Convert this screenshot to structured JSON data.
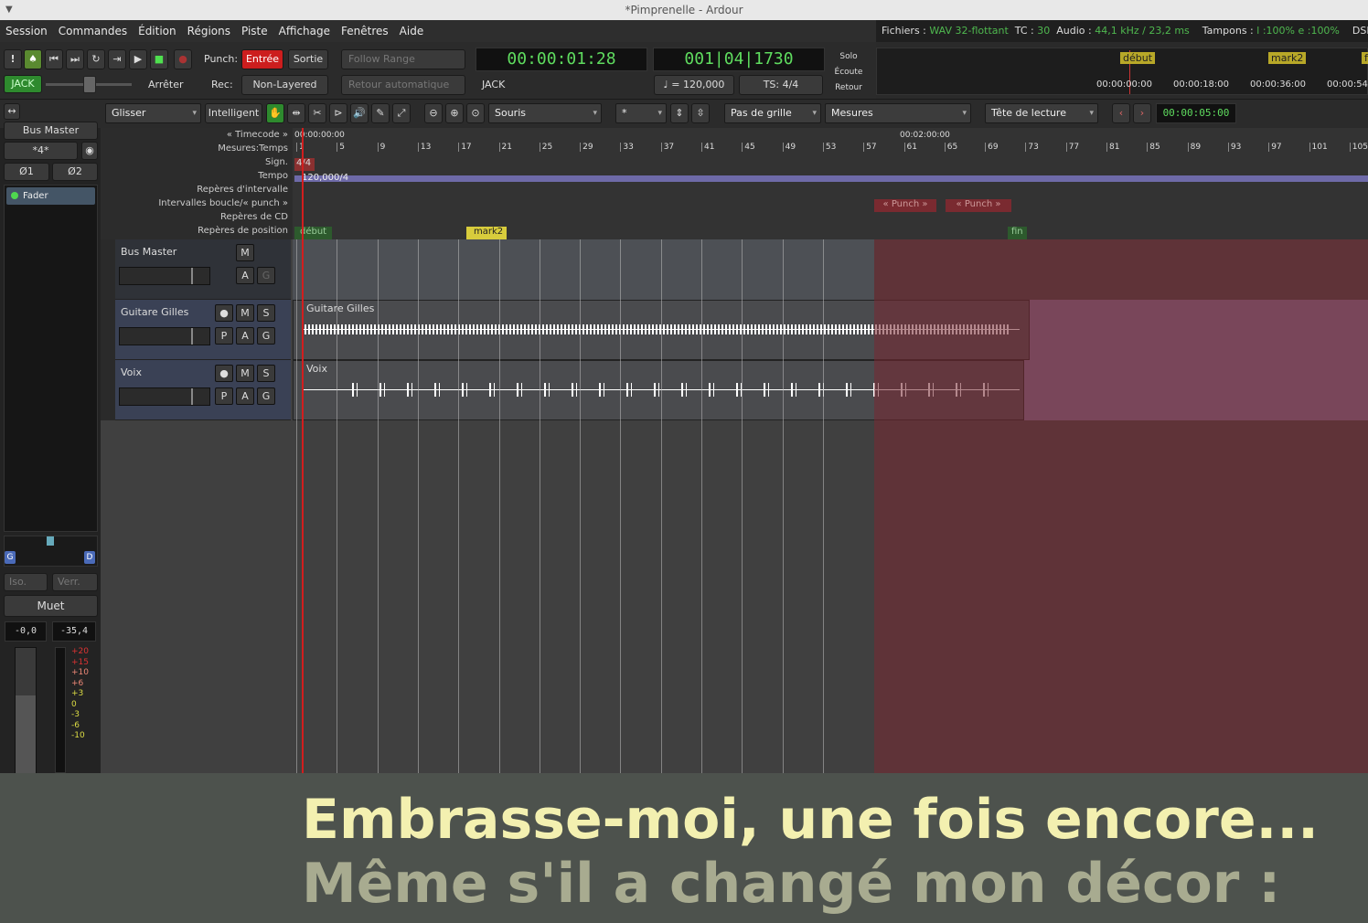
{
  "window": {
    "title": "*Pimprenelle - Ardour"
  },
  "menu": [
    "Session",
    "Commandes",
    "Édition",
    "Régions",
    "Piste",
    "Affichage",
    "Fenêtres",
    "Aide"
  ],
  "status": {
    "files_label": "Fichiers :",
    "files_value": "WAV 32-flottant",
    "tc_label": "TC :",
    "tc_value": "30",
    "audio_label": "Audio :",
    "audio_value": "44,1 kHz / 23,2 ms",
    "buffers_label": "Tampons :",
    "buffers_value": "l :100% e :100%",
    "dsp_label": "DSP :"
  },
  "transport": {
    "punch_label": "Punch:",
    "punch_in": "Entrée",
    "punch_out": "Sortie",
    "follow_range": "Follow Range",
    "auto_return": "Retour automatique",
    "rec_label": "Rec:",
    "rec_mode": "Non-Layered",
    "jack_button": "JACK",
    "stop_label": "Arrêter",
    "jack_label": "JACK",
    "clock_primary": "00:00:01:28",
    "clock_secondary": "001|04|1730",
    "tempo": "♩ = 120,000",
    "ts": "TS: 4/4",
    "solo": "Solo",
    "ecoute": "Écoute",
    "retour": "Retour"
  },
  "minitimeline": {
    "marker1": "début",
    "marker2": "mark2",
    "marker3": "f",
    "t0": "00:00:00:00",
    "t1": "00:00:18:00",
    "t2": "00:00:36:00",
    "t3": "00:00:54:"
  },
  "toolbar": {
    "edit_mode": "Glisser",
    "smart": "Intelligent",
    "edit_point": "Souris",
    "zoom_focus": "*",
    "grid": "Pas de grille",
    "grid_unit": "Mesures",
    "playhead": "Tête de lecture",
    "nudge_clock": "00:00:05:00"
  },
  "editor_mixer": {
    "strip_name": "Bus Master",
    "input": "*4*",
    "phase1": "Ø1",
    "phase2": "Ø2",
    "fader_label": "Fader",
    "pan_left": "G",
    "pan_right": "D",
    "iso": "Iso.",
    "verr": "Verr.",
    "mute": "Muet",
    "gain": "-0,0",
    "peak": "-35,4",
    "meter_ticks": [
      "+20",
      "+15",
      "+10",
      "+6",
      "+3",
      "0",
      "-3",
      "-6",
      "-10"
    ]
  },
  "rulers": {
    "labels": [
      "« Timecode »",
      "Mesures:Temps",
      "Sign.",
      "Tempo",
      "Repères d'intervalle",
      "Intervalles boucle/« punch »",
      "Repères de CD",
      "Repères de position"
    ],
    "tc0": "00:00:00:00",
    "tc1": "00:02:00:00",
    "bars": [
      "1",
      "5",
      "9",
      "13",
      "17",
      "21",
      "25",
      "29",
      "33",
      "37",
      "41",
      "45",
      "49",
      "53",
      "57",
      "61",
      "65",
      "69",
      "73",
      "77",
      "81",
      "85",
      "89",
      "93",
      "97",
      "101",
      "105"
    ],
    "sig": "4/4",
    "tempo": "120,000/4",
    "punch1": "« Punch »",
    "punch2": "« Punch »",
    "marker_debut": "début",
    "marker_mark2": "mark2",
    "marker_fin": "fin"
  },
  "tracks": [
    {
      "name": "Bus Master",
      "region": ""
    },
    {
      "name": "Guitare Gilles",
      "region": "Guitare Gilles"
    },
    {
      "name": "Voix",
      "region": "Voix"
    }
  ],
  "buttons": {
    "m": "M",
    "s": "S",
    "p": "P",
    "a": "A",
    "g": "G"
  },
  "lyrics": {
    "line1": "Embrasse-moi, une fois encore...",
    "line2": "Même s'il a changé mon décor :"
  },
  "colors": {
    "green": "#4fb84f",
    "red_btn": "#cc1e1e",
    "marker_yellow": "#d8cc3c",
    "punch_range": "#5c3338"
  }
}
